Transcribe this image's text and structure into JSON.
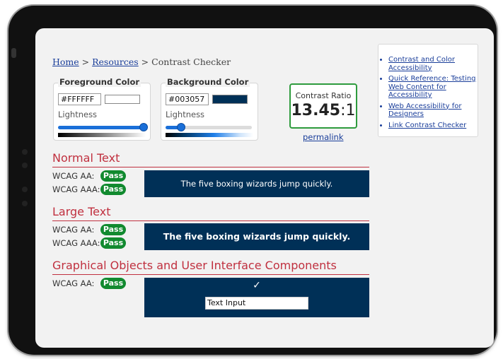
{
  "breadcrumb": {
    "home": "Home",
    "sep1": " > ",
    "resources": "Resources",
    "sep2": " > ",
    "current": "Contrast Checker"
  },
  "foreground": {
    "legend": "Foreground Color",
    "hex": "#FFFFFF",
    "swatch_color": "#ffffff",
    "lightness_label": "Lightness",
    "lightness_fraction": 1.0
  },
  "background": {
    "legend": "Background Color",
    "hex": "#003057",
    "swatch_color": "#003057",
    "lightness_label": "Lightness",
    "lightness_fraction": 0.17
  },
  "ratio": {
    "label": "Contrast Ratio",
    "value": "13.45",
    "suffix": ":1",
    "border_color": "#2e9b3d"
  },
  "permalink": "permalink",
  "side_links": [
    "Contrast and Color Accessibility",
    "Quick Reference: Testing Web Content for Accessibility",
    "Web Accessibility for Designers",
    "Link Contrast Checker"
  ],
  "normal_text": {
    "title": "Normal Text",
    "aa_label": "WCAG AA:",
    "aa_result": "Pass",
    "aaa_label": "WCAG AAA:",
    "aaa_result": "Pass",
    "sample": "The five boxing wizards jump quickly."
  },
  "large_text": {
    "title": "Large Text",
    "aa_label": "WCAG AA:",
    "aa_result": "Pass",
    "aaa_label": "WCAG AAA:",
    "aaa_result": "Pass",
    "sample": "The five boxing wizards jump quickly."
  },
  "graphical": {
    "title": "Graphical Objects and User Interface Components",
    "aa_label": "WCAG AA:",
    "aa_result": "Pass",
    "check_glyph": "✓",
    "input_value": "Text Input"
  },
  "colors": {
    "pass_green": "#118a2f",
    "heading_red": "#c0303f",
    "sample_bg": "#003057",
    "link_blue": "#1a3e9a"
  }
}
